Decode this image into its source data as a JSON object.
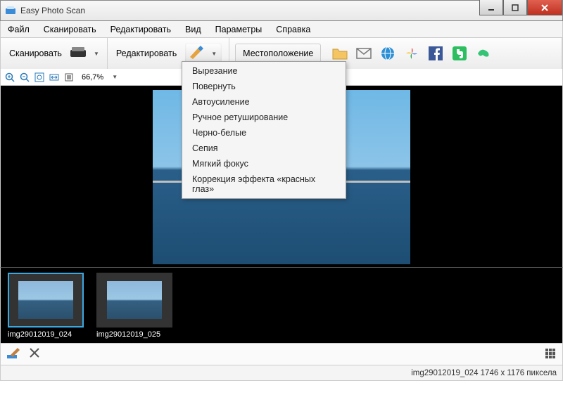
{
  "window": {
    "title": "Easy Photo Scan"
  },
  "menu": [
    "Файл",
    "Сканировать",
    "Редактировать",
    "Вид",
    "Параметры",
    "Справка"
  ],
  "toolbar": {
    "scan_label": "Сканировать",
    "edit_label": "Редактировать",
    "dest_label": "Местоположение"
  },
  "edit_menu": [
    "Вырезание",
    "Повернуть",
    "Автоусиление",
    "Ручное ретуширование",
    "Черно-белые",
    "Сепия",
    "Мягкий фокус",
    "Коррекция эффекта «красных глаз»"
  ],
  "zoom": {
    "value": "66,7%"
  },
  "thumbs": [
    {
      "name": "img29012019_024",
      "selected": true
    },
    {
      "name": "img29012019_025",
      "selected": false
    }
  ],
  "status": "img29012019_024 1746 x 1176 пиксела"
}
